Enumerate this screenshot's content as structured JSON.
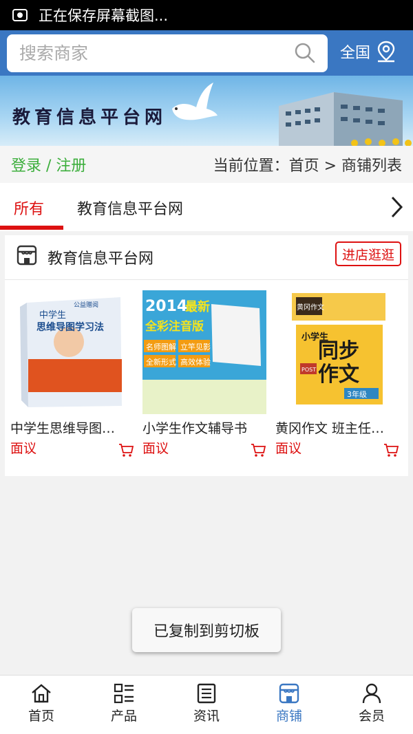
{
  "status_bar": {
    "text": "正在保存屏幕截图..."
  },
  "header": {
    "search_placeholder": "搜索商家",
    "region": "全国"
  },
  "banner": {
    "title": "教育信息平台网"
  },
  "login_row": {
    "login": "登录 / 注册",
    "breadcrumb": "当前位置：首页 > 商铺列表"
  },
  "tabs": [
    {
      "label": "所有",
      "active": true
    },
    {
      "label": "教育信息平台网",
      "active": false
    }
  ],
  "shop": {
    "name": "教育信息平台网",
    "enter_button": "进店逛逛",
    "products": [
      {
        "name": "中学生思维导图…",
        "price": "面议",
        "cover": {
          "top": "中学生",
          "title": "思维导图学习法",
          "badge": "公益赠阅"
        }
      },
      {
        "name": "小学生作文辅导书",
        "price": "面议",
        "cover": {
          "year": "2014",
          "tag": "最新",
          "title": "全彩注音版",
          "b1": "名师图解",
          "b2": "立竿见影",
          "b3": "全新形式",
          "b4": "高效体验"
        }
      },
      {
        "name": "黄冈作文 班主任…",
        "price": "面议",
        "cover": {
          "brand": "黄冈作文",
          "title1": "同步",
          "title2": "作文",
          "grade": "3年级",
          "post": "POST",
          "side": "小学生"
        }
      }
    ]
  },
  "toast": "已复制到剪切板",
  "bottom_nav": [
    {
      "label": "首页",
      "icon": "home-icon"
    },
    {
      "label": "产品",
      "icon": "grid-list-icon"
    },
    {
      "label": "资讯",
      "icon": "news-icon"
    },
    {
      "label": "商铺",
      "icon": "shop-icon",
      "active": true
    },
    {
      "label": "会员",
      "icon": "user-icon"
    }
  ],
  "colors": {
    "primary": "#3a77c2",
    "accent": "#dd1111",
    "login_green": "#3cae3c"
  }
}
